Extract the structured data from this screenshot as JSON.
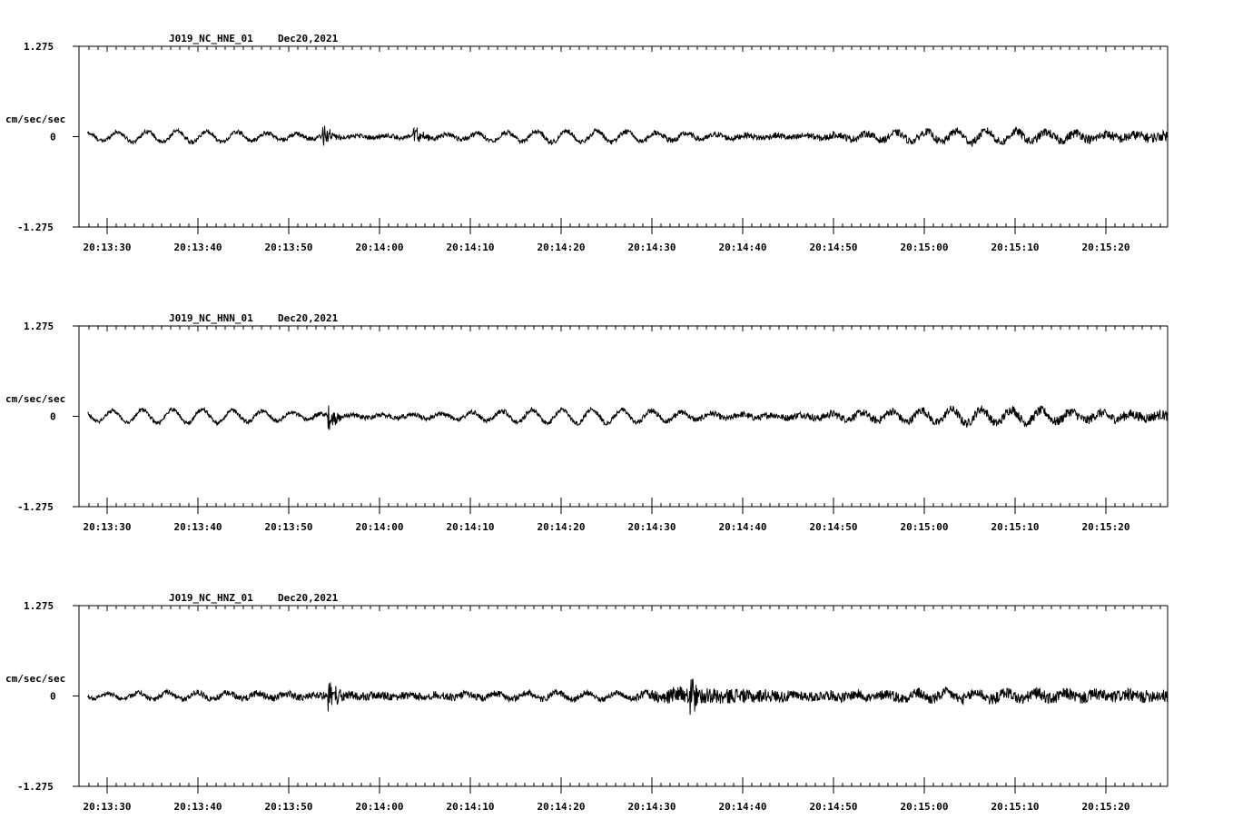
{
  "chart_data": [
    {
      "type": "line",
      "title": "J019_NC_HNE_01",
      "date": "Dec20,2021",
      "ylabel": "cm/sec/sec",
      "ylim": [
        -1.275,
        1.275
      ],
      "yticks": [
        "1.275",
        "0",
        "-1.275"
      ],
      "xticks": [
        "20:13:30",
        "20:13:40",
        "20:13:50",
        "20:14:00",
        "20:14:10",
        "20:14:20",
        "20:14:30",
        "20:14:40",
        "20:14:50",
        "20:15:00",
        "20:15:10",
        "20:15:20"
      ],
      "xrange_seconds_from_20_13_27": [
        0,
        120
      ],
      "series": [
        {
          "amplitude": 0.1,
          "noise": [
            [
              0,
              0.04
            ],
            [
              60,
              0.05
            ],
            [
              100,
              0.08
            ],
            [
              120,
              0.1
            ]
          ],
          "bursts": [
            [
              27,
              0.18
            ],
            [
              37,
              0.12
            ]
          ],
          "osc": 0.08
        }
      ]
    },
    {
      "type": "line",
      "title": "J019_NC_HNN_01",
      "date": "Dec20,2021",
      "ylabel": "cm/sec/sec",
      "ylim": [
        -1.275,
        1.275
      ],
      "yticks": [
        "1.275",
        "0",
        "-1.275"
      ],
      "xticks": [
        "20:13:30",
        "20:13:40",
        "20:13:50",
        "20:14:00",
        "20:14:10",
        "20:14:20",
        "20:14:30",
        "20:14:40",
        "20:14:50",
        "20:15:00",
        "20:15:10",
        "20:15:20"
      ],
      "xrange_seconds_from_20_13_27": [
        0,
        120
      ],
      "series": [
        {
          "amplitude": 0.12,
          "noise": [
            [
              0,
              0.04
            ],
            [
              60,
              0.05
            ],
            [
              100,
              0.09
            ],
            [
              120,
              0.1
            ]
          ],
          "bursts": [
            [
              27.6,
              0.18
            ]
          ],
          "osc": 0.1
        }
      ]
    },
    {
      "type": "line",
      "title": "J019_NC_HNZ_01",
      "date": "Dec20,2021",
      "ylabel": "cm/sec/sec",
      "ylim": [
        -1.275,
        1.275
      ],
      "yticks": [
        "1.275",
        "0",
        "-1.275"
      ],
      "xticks": [
        "20:13:30",
        "20:13:40",
        "20:13:50",
        "20:14:00",
        "20:14:10",
        "20:14:20",
        "20:14:30",
        "20:14:40",
        "20:14:50",
        "20:15:00",
        "20:15:10",
        "20:15:20"
      ],
      "xrange_seconds_from_20_13_27": [
        0,
        120
      ],
      "series": [
        {
          "amplitude": 0.06,
          "noise": [
            [
              0,
              0.04
            ],
            [
              27,
              0.08
            ],
            [
              40,
              0.08
            ],
            [
              60,
              0.05
            ],
            [
              67,
              0.18
            ],
            [
              80,
              0.1
            ],
            [
              120,
              0.13
            ]
          ],
          "bursts": [
            [
              27.6,
              0.3
            ],
            [
              67.5,
              0.2
            ]
          ],
          "osc": 0.05
        }
      ]
    }
  ]
}
